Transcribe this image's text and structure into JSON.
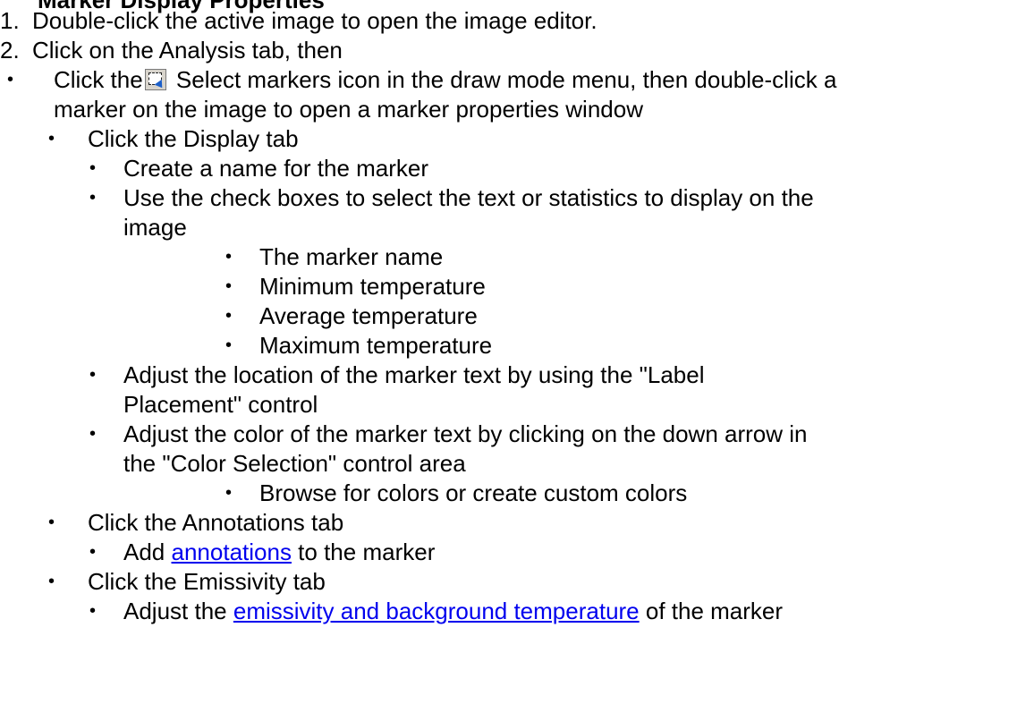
{
  "heading_fragment": "Marker Display Properties",
  "steps": [
    {
      "number": "1.",
      "text": "Double-click the active image to open the image editor."
    },
    {
      "number": "2.",
      "text": "Click on the Analysis tab, then"
    }
  ],
  "bullet_glyph": "•",
  "select_markers": {
    "prefix": "Click the",
    "icon": "select-markers-icon",
    "line1": " Select markers icon in the draw mode menu, then double-click a",
    "line2": "marker on the image to open a marker properties window"
  },
  "display_tab": {
    "label": "Click the Display tab",
    "items": {
      "create_name": "Create a name for the marker",
      "check_boxes_line1": "Use the check boxes to select the text or statistics to display on the",
      "check_boxes_line2": "image",
      "stats": [
        "The marker name",
        "Minimum temperature",
        "Average temperature",
        "Maximum temperature"
      ],
      "placement_line1": "Adjust the location of the marker text by using the \"Label",
      "placement_line2": "Placement\" control",
      "color_line1": "Adjust the color of the marker text by clicking on the down arrow in",
      "color_line2": "the \"Color Selection\" control area",
      "color_sub": "Browse for colors or create custom colors"
    }
  },
  "annotations_tab": {
    "label": "Click the Annotations tab",
    "item_prefix": "Add ",
    "item_link": "annotations",
    "item_suffix": " to the marker"
  },
  "emissivity_tab": {
    "label": "Click the Emissivity tab",
    "item_prefix": "Adjust the ",
    "item_link": "emissivity and background temperature",
    "item_suffix": " of the marker"
  },
  "colors": {
    "text": "#000000",
    "link": "#0000ee",
    "background": "#ffffff"
  }
}
